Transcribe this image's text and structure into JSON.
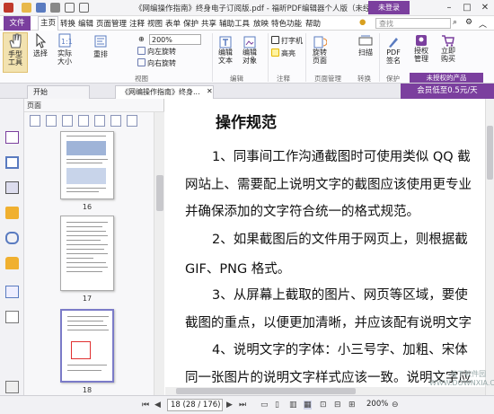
{
  "titlebar": {
    "title": "《网编操作指南》终身电子订阅版.pdf - 福昕PDF编辑器个人版（未经授权的...",
    "login": "未登录",
    "unlogged": "未登录"
  },
  "menu": {
    "file": "文件",
    "items": [
      "主页",
      "转换",
      "编辑",
      "页面管理",
      "注释",
      "视图",
      "表单",
      "保护",
      "共享",
      "辅助工具",
      "放映",
      "特色功能",
      "帮助"
    ],
    "search_placeholder": "查找"
  },
  "ribbon": {
    "hand": "手型\n工具",
    "select": "选择",
    "actual": "实际\n大小",
    "reflow": "重排",
    "zoom": "200%",
    "rotate_left": "向左旋转",
    "rotate_right": "向右旋转",
    "view_group": "视图",
    "edit_text": "编辑\n文本",
    "edit_obj": "编辑\n对象",
    "edit_group": "编辑",
    "typewriter": "打字机",
    "highlight": "高亮",
    "annot_group": "注释",
    "rotate_page": "旋转\n页面",
    "page_group": "页面管理",
    "scan": "扫描",
    "convert_group": "转换",
    "pdf_sign": "PDF\n签名",
    "protect_group": "保护",
    "license_manage": "授权\n管理",
    "buy_now": "立即\n购买",
    "unlicensed": "未授权的产品"
  },
  "tabs": [
    {
      "label": "开始"
    },
    {
      "label": "《网编操作指南》终身..."
    }
  ],
  "promo": "会员低至0.5元/天",
  "panel": {
    "title": "页面",
    "thumbs": [
      {
        "num": "16"
      },
      {
        "num": "17"
      },
      {
        "num": "18"
      }
    ]
  },
  "document": {
    "heading": "操作规范",
    "lines": [
      "1、同事间工作沟通截图时可使用类似 QQ 截",
      "网站上、需要配上说明文字的截图应该使用更专业",
      "并确保添加的文字符合统一的格式规范。",
      "2、如果截图后的文件用于网页上，则根据截",
      "GIF、PNG 格式。",
      "3、从屏幕上截取的图片、网页等区域，要使",
      "截图的重点，以便更加清晰，并应该配有说明文字",
      "4、说明文字的字体：小三号字、加粗、宋体",
      "同一张图片的说明文字样式应该一致。说明文字应"
    ]
  },
  "status": {
    "page": "18 (28 / 176)",
    "zoom": "200%"
  },
  "watermark": "当下软件园\nWWW.DOWNXIA.COM",
  "colors": {
    "accent": "#7b3f9e",
    "highlight_box": "#e03030"
  }
}
